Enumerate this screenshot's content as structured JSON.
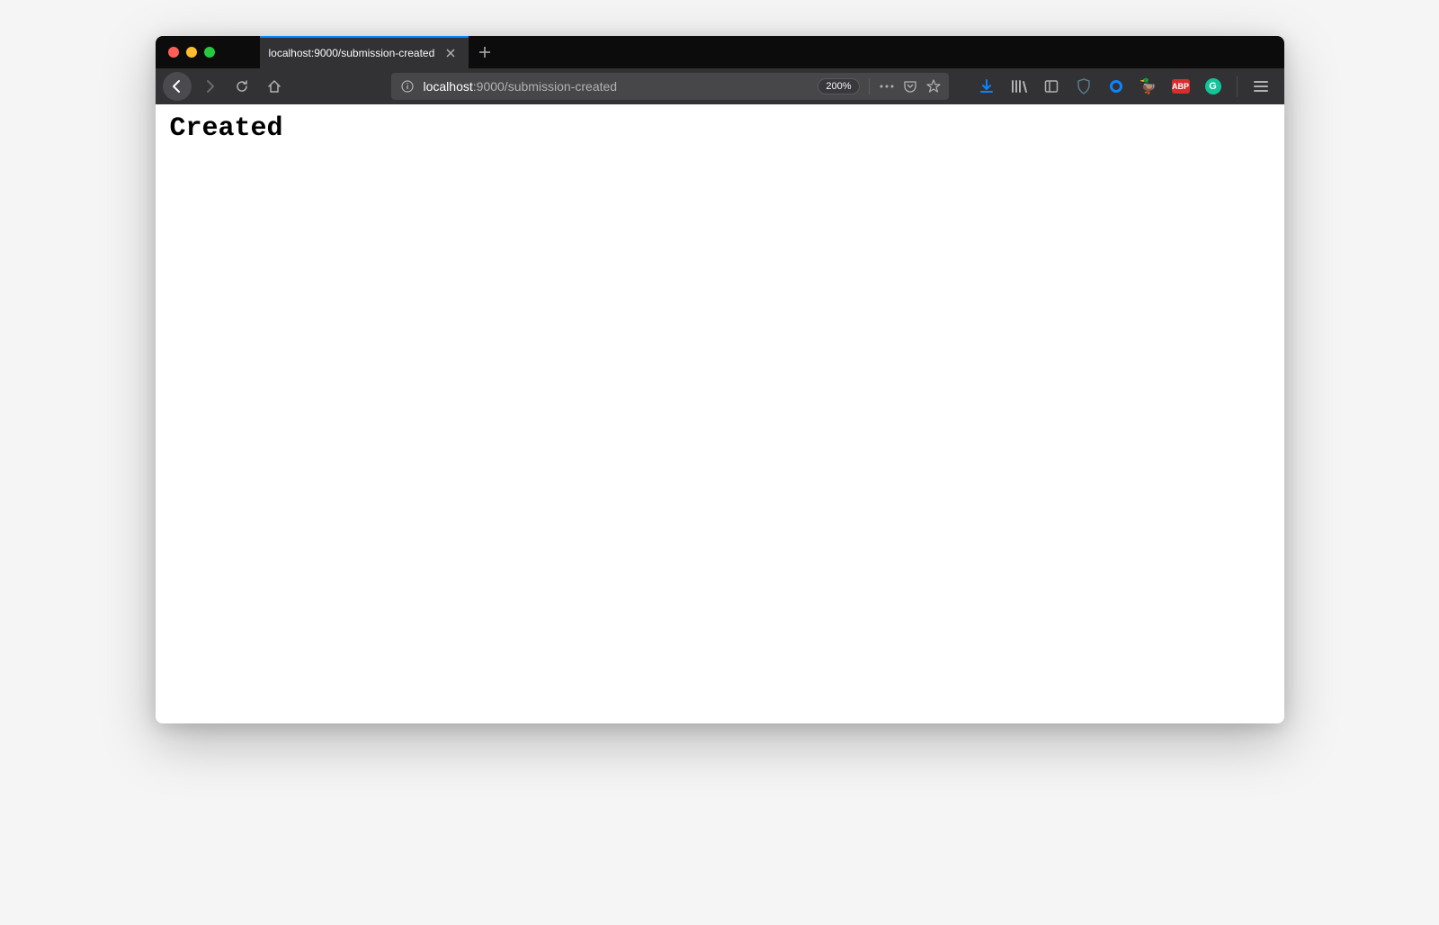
{
  "tab": {
    "title": "localhost:9000/submission-created"
  },
  "url": {
    "host": "localhost",
    "path": ":9000/submission-created"
  },
  "zoom": "200%",
  "extensions": {
    "abp": "ABP",
    "grammarly": "G"
  },
  "page": {
    "body": "Created"
  }
}
